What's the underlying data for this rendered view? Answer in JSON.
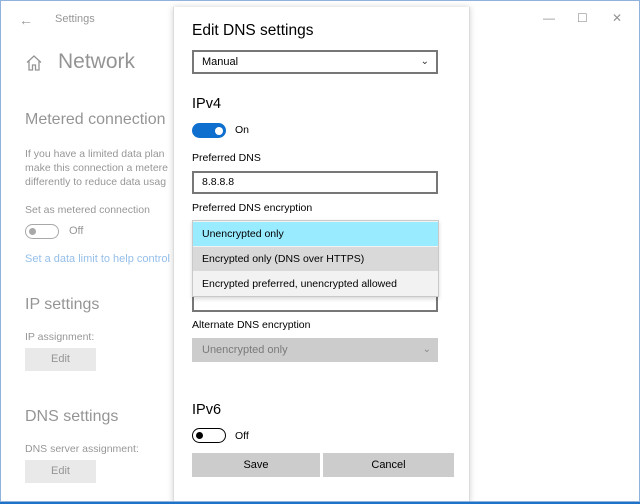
{
  "window": {
    "title": "Settings",
    "back_glyph": "←",
    "minimize_glyph": "—",
    "maximize_glyph": "☐",
    "close_glyph": "✕"
  },
  "background": {
    "page_title": "Network",
    "metered": {
      "heading": "Metered connection",
      "description_lines": [
        "If you have a limited data plan",
        "make this connection a metere",
        "differently to reduce data usag"
      ],
      "set_label": "Set as metered connection",
      "toggle_state": "Off",
      "link": "Set a data limit to help control"
    },
    "ip_settings": {
      "heading": "IP settings",
      "label": "IP assignment:",
      "button": "Edit"
    },
    "dns_settings": {
      "heading": "DNS settings",
      "label": "DNS server assignment:",
      "button": "Edit"
    }
  },
  "dialog": {
    "title": "Edit DNS settings",
    "mode_select": "Manual",
    "ipv4": {
      "heading": "IPv4",
      "toggle_state": "On",
      "preferred_dns_label": "Preferred DNS",
      "preferred_dns_value": "8.8.8.8",
      "preferred_encryption_label": "Preferred DNS encryption",
      "encryption_options": [
        "Unencrypted only",
        "Encrypted only (DNS over HTTPS)",
        "Encrypted preferred, unencrypted allowed"
      ],
      "alternate_encryption_label": "Alternate DNS encryption",
      "alternate_encryption_value": "Unencrypted only"
    },
    "ipv6": {
      "heading": "IPv6",
      "toggle_state": "Off"
    },
    "save_label": "Save",
    "cancel_label": "Cancel"
  },
  "colors": {
    "accent": "#0f6fcf",
    "selected_option": "#99ebff",
    "hover_option": "#d9d9d9",
    "desktop": "#1e73c8"
  }
}
